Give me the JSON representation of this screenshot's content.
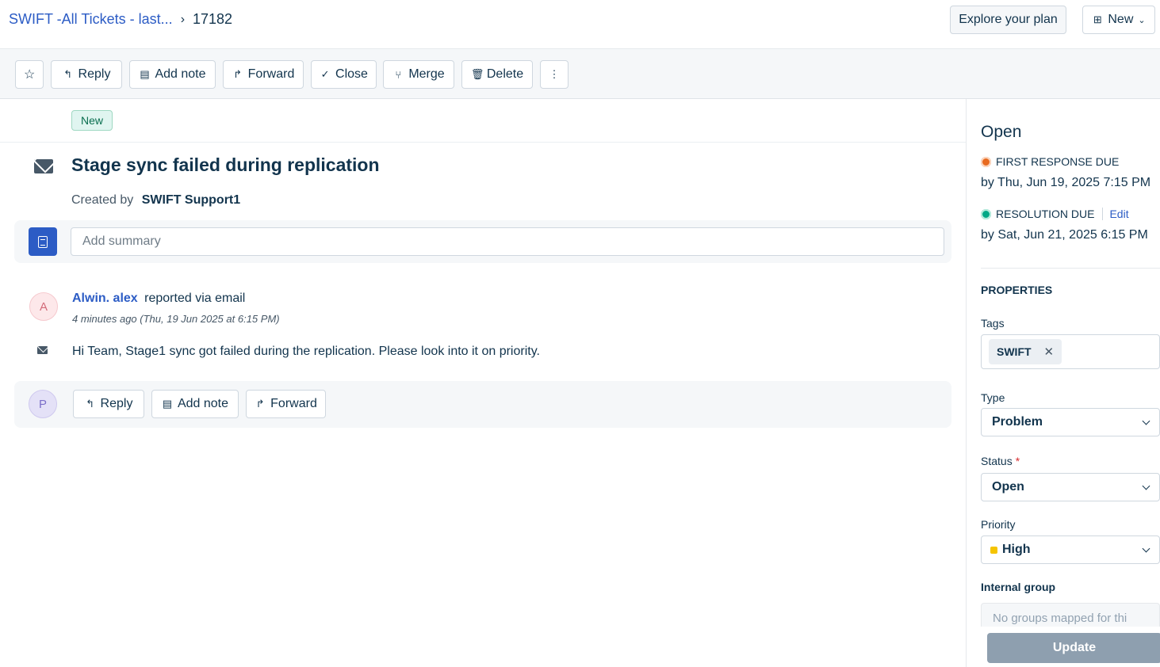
{
  "header": {
    "breadcrumb_parent": "SWIFT -All Tickets - last...",
    "ticket_id": "17182",
    "explore_label": "Explore your plan",
    "new_label": "New"
  },
  "toolbar": {
    "reply": "Reply",
    "add_note": "Add note",
    "forward": "Forward",
    "close": "Close",
    "merge": "Merge",
    "delete": "Delete"
  },
  "ticket": {
    "badge": "New",
    "title": "Stage sync failed during replication",
    "created_by_label": "Created by",
    "created_by": "SWIFT Support1",
    "summary_placeholder": "Add summary"
  },
  "conversation": {
    "avatar_initial": "A",
    "reporter_name": "Alwin. alex",
    "reported_via": "reported via email",
    "time_ago": "4 minutes ago (Thu, 19 Jun 2025 at 6:15 PM)",
    "message": "Hi Team, Stage1 sync got failed during the replication. Please look into it on priority."
  },
  "reply_bar": {
    "avatar_initial": "P",
    "reply": "Reply",
    "add_note": "Add note",
    "forward": "Forward"
  },
  "sidebar": {
    "status": "Open",
    "first_response_label": "FIRST RESPONSE DUE",
    "first_response_date": "by Thu, Jun 19, 2025 7:15 PM",
    "resolution_label": "RESOLUTION DUE",
    "edit_label": "Edit",
    "resolution_date": "by Sat, Jun 21, 2025 6:15 PM",
    "properties_label": "PROPERTIES",
    "tags_label": "Tags",
    "tags": [
      "SWIFT"
    ],
    "type_label": "Type",
    "type_value": "Problem",
    "status_label": "Status",
    "status_value": "Open",
    "priority_label": "Priority",
    "priority_value": "High",
    "priority_color": "#f5c400",
    "group_label": "Internal group",
    "group_placeholder": "No groups mapped for thi",
    "update_label": "Update"
  },
  "colors": {
    "link": "#2c5cc5",
    "first_response_dot": "#e86a1f",
    "resolution_dot": "#00a886",
    "update_button": "#8e9faf"
  }
}
